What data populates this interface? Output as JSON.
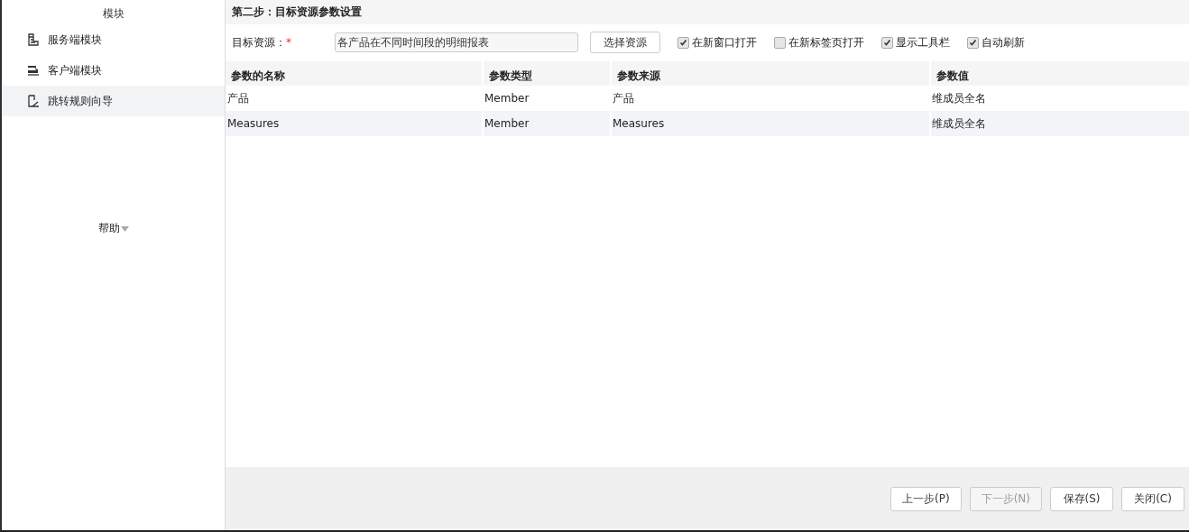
{
  "sidebar": {
    "title": "模块",
    "items": [
      {
        "label": "服务端模块",
        "selected": false
      },
      {
        "label": "客户端模块",
        "selected": false
      },
      {
        "label": "跳转规则向导",
        "selected": true
      }
    ],
    "help": "帮助"
  },
  "step_title": "第二步：目标资源参数设置",
  "target": {
    "label": "目标资源：",
    "required": "*",
    "value": "各产品在不同时间段的明细报表",
    "button": "选择资源"
  },
  "options": [
    {
      "label": "在新窗口打开",
      "checked": true
    },
    {
      "label": "在新标签页打开",
      "checked": false
    },
    {
      "label": "显示工具栏",
      "checked": true
    },
    {
      "label": "自动刷新",
      "checked": true
    }
  ],
  "table": {
    "columns": [
      "参数的名称",
      "参数类型",
      "参数来源",
      "参数值"
    ],
    "rows": [
      [
        "产品",
        "Member",
        "产品",
        "维成员全名"
      ],
      [
        "Measures",
        "Member",
        "Measures",
        "维成员全名"
      ]
    ]
  },
  "buttons": [
    {
      "label": "上一步(P)",
      "disabled": false
    },
    {
      "label": "下一步(N)",
      "disabled": true
    },
    {
      "label": "保存(S)",
      "disabled": false
    },
    {
      "label": "关闭(C)",
      "disabled": false
    }
  ]
}
